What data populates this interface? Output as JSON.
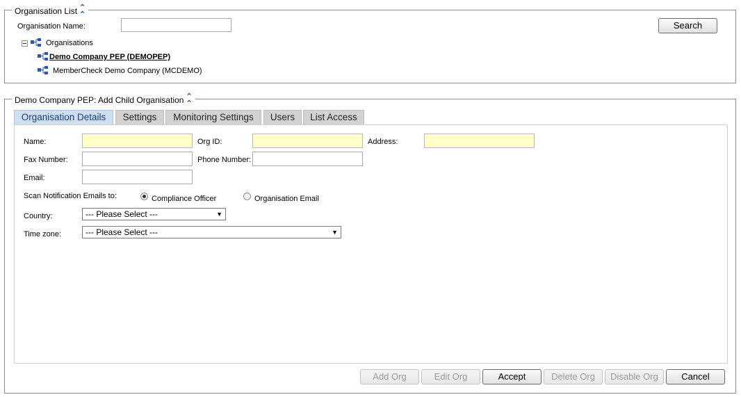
{
  "org_list": {
    "legend": "Organisation List",
    "name_label": "Organisation Name:",
    "name_value": "",
    "search_label": "Search",
    "tree": {
      "root_label": "Organisations",
      "items": [
        {
          "label": "Demo Company PEP (DEMOPEP)",
          "selected": true
        },
        {
          "label": "MemberCheck Demo Company (MCDEMO)",
          "selected": false
        }
      ]
    }
  },
  "child_org": {
    "legend": "Demo Company PEP: Add Child Organisation",
    "tabs": [
      {
        "label": "Organisation Details",
        "active": true
      },
      {
        "label": "Settings",
        "active": false
      },
      {
        "label": "Monitoring Settings",
        "active": false
      },
      {
        "label": "Users",
        "active": false
      },
      {
        "label": "List Access",
        "active": false
      }
    ],
    "form": {
      "name_label": "Name:",
      "orgid_label": "Org ID:",
      "address_label": "Address:",
      "fax_label": "Fax Number:",
      "phone_label": "Phone Number:",
      "email_label": "Email:",
      "scan_label": "Scan Notification Emails to:",
      "radio_compliance": "Compliance Officer",
      "radio_org_email": "Organisation Email",
      "country_label": "Country:",
      "country_value": "--- Please Select ---",
      "timezone_label": "Time zone:",
      "timezone_value": "--- Please Select ---"
    },
    "buttons": {
      "add_org": "Add Org",
      "edit_org": "Edit Org",
      "accept": "Accept",
      "delete_org": "Delete Org",
      "disable_org": "Disable Org",
      "cancel": "Cancel"
    }
  },
  "colors": {
    "required_field": "#ffffc7",
    "active_tab": "#cfdff2",
    "inactive_tab": "#d2d2d2",
    "tree_icon": "#2b57a6"
  }
}
